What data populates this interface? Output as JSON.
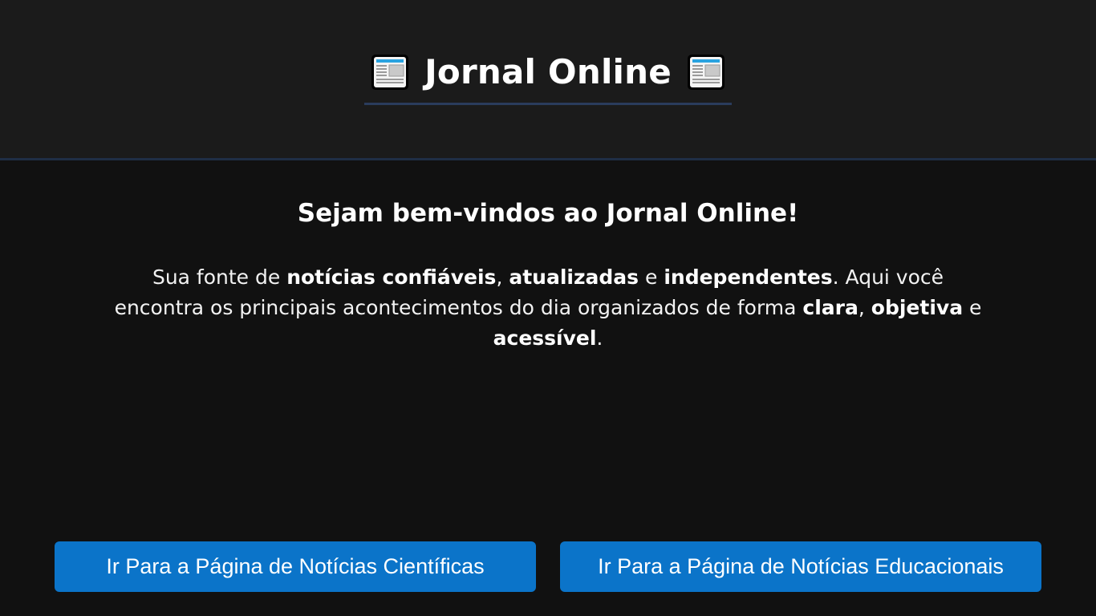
{
  "header": {
    "title": "Jornal Online",
    "title_icon": "newspaper-icon"
  },
  "main": {
    "welcome": "Sejam bem-vindos ao Jornal Online!",
    "intro": {
      "t1": "Sua fonte de ",
      "b1": "notícias confiáveis",
      "t2": ", ",
      "b2": "atualizadas",
      "t3": " e ",
      "b3": "independentes",
      "t4": ". Aqui você encontra os principais acontecimentos do dia organizados de forma ",
      "b4": "clara",
      "t5": ", ",
      "b5": "objetiva",
      "t6": " e ",
      "b6": "acessível",
      "t7": "."
    }
  },
  "buttons": {
    "science_label": "Ir Para a Página de Notícias Científicas",
    "education_label": "Ir Para a Página de Notícias Educacionais"
  },
  "colors": {
    "header_bg": "#1b1b1b",
    "page_bg": "#111111",
    "accent_line": "#2a3c5c",
    "button_bg": "#0b74c9"
  }
}
